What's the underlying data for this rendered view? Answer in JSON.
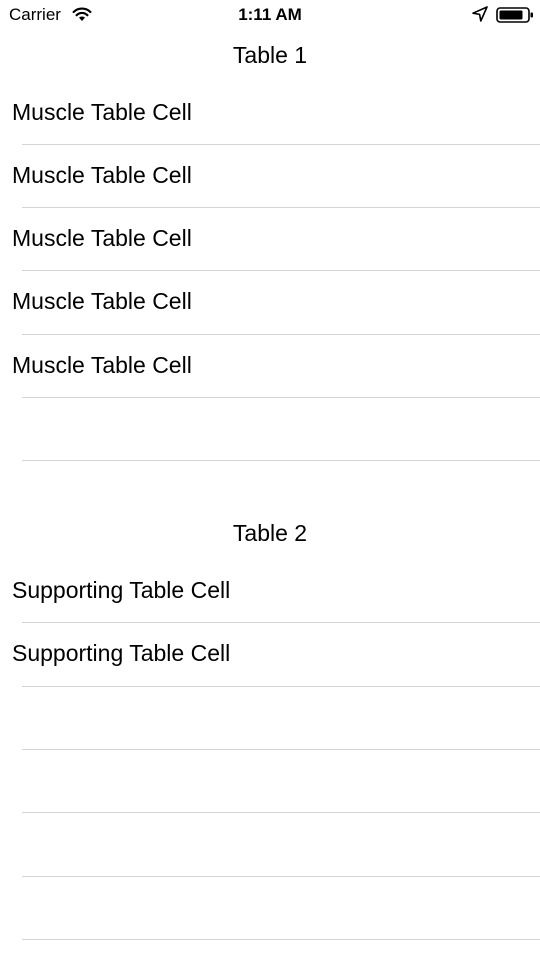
{
  "status_bar": {
    "carrier": "Carrier",
    "time": "1:11 AM",
    "icons": [
      "wifi-icon",
      "location-arrow-icon",
      "battery-icon"
    ]
  },
  "table1": {
    "title": "Table 1",
    "cells": [
      {
        "label": "Muscle Table Cell"
      },
      {
        "label": "Muscle Table Cell"
      },
      {
        "label": "Muscle Table Cell"
      },
      {
        "label": "Muscle Table Cell"
      },
      {
        "label": "Muscle Table Cell"
      }
    ]
  },
  "table2": {
    "title": "Table 2",
    "cells": [
      {
        "label": "Supporting Table Cell"
      },
      {
        "label": "Supporting Table Cell"
      }
    ]
  },
  "colors": {
    "background": "#ffffff",
    "text": "#000000",
    "separator": "#d4d4d6"
  }
}
